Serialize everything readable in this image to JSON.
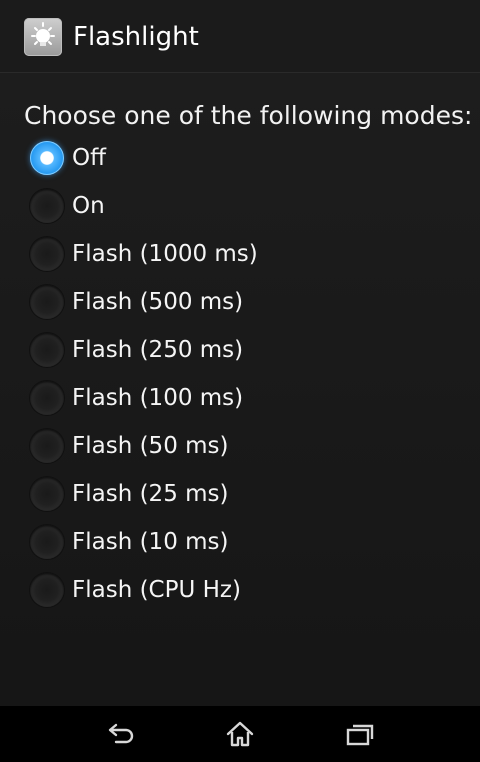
{
  "app": {
    "title": "Flashlight",
    "icon": "bulb-app-icon"
  },
  "prompt": "Choose one of the following modes:",
  "modes": [
    {
      "label": "Off",
      "selected": true
    },
    {
      "label": "On",
      "selected": false
    },
    {
      "label": "Flash (1000 ms)",
      "selected": false
    },
    {
      "label": "Flash (500 ms)",
      "selected": false
    },
    {
      "label": "Flash (250 ms)",
      "selected": false
    },
    {
      "label": "Flash (100 ms)",
      "selected": false
    },
    {
      "label": "Flash (50 ms)",
      "selected": false
    },
    {
      "label": "Flash (25 ms)",
      "selected": false
    },
    {
      "label": "Flash (10 ms)",
      "selected": false
    },
    {
      "label": "Flash (CPU Hz)",
      "selected": false
    }
  ],
  "navigation": {
    "back_icon": "back-icon",
    "home_icon": "home-icon",
    "recents_icon": "recent-apps-icon"
  },
  "colors": {
    "accent": "#2a9cf2",
    "background": "#1a1a1a",
    "nav_bar": "#000000"
  }
}
